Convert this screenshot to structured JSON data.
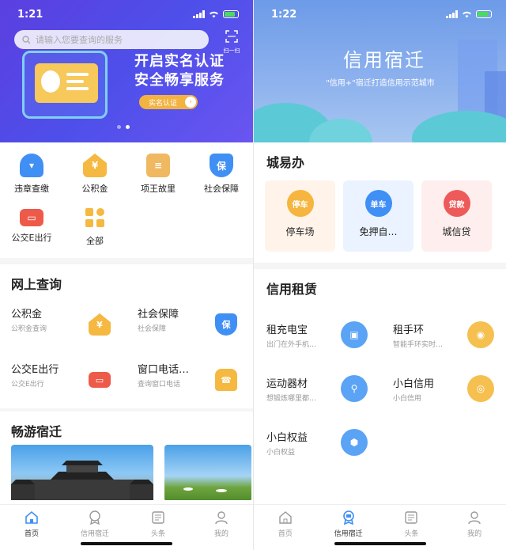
{
  "left": {
    "status": {
      "time": "1:21"
    },
    "search": {
      "placeholder": "请输入您要查询的服务"
    },
    "scan": {
      "label": "扫一扫"
    },
    "banner": {
      "line1": "开启实名认证",
      "line2": "安全畅享服务",
      "cta": "实名认证"
    },
    "grid": [
      {
        "label": "违章查缴",
        "icon": "police-hat-icon",
        "color": "#3f8ff5"
      },
      {
        "label": "公积金",
        "icon": "house-fund-icon",
        "color": "#f5b840"
      },
      {
        "label": "项王故里",
        "icon": "scroll-icon",
        "color": "#f0b860"
      },
      {
        "label": "社会保障",
        "icon": "shield-icon",
        "color": "#3f8ff5"
      },
      {
        "label": "公交E出行",
        "icon": "bus-icon",
        "color": "#ee5a4a"
      },
      {
        "label": "全部",
        "icon": "grid-all-icon",
        "color": "#f5b840"
      }
    ],
    "online_title": "网上查询",
    "queries": [
      {
        "title": "公积金",
        "sub": "公积金查询",
        "icon": "house-fund-icon"
      },
      {
        "title": "社会保障",
        "sub": "社会保障",
        "icon": "shield-icon"
      },
      {
        "title": "公交E出行",
        "sub": "公交E出行",
        "icon": "bus-icon"
      },
      {
        "title": "窗口电话…",
        "sub": "查询窗口电话",
        "icon": "telephone-icon"
      }
    ],
    "tour_title": "畅游宿迁",
    "tabs": [
      "首页",
      "信用宿迁",
      "头条",
      "我的"
    ]
  },
  "right": {
    "status": {
      "time": "1:22"
    },
    "banner": {
      "title": "信用宿迁",
      "sub": "\"信用+\"宿迁打造信用示范城市"
    },
    "city_title": "城易办",
    "city_cards": [
      {
        "label": "停车场",
        "badge": "停车",
        "icon": "parking-icon",
        "bg": "#fff3ea",
        "color": "#f5b53f"
      },
      {
        "label": "免押自…",
        "badge": "单车",
        "icon": "bike-icon",
        "bg": "#eaf3ff",
        "color": "#3f8ff5"
      },
      {
        "label": "城信贷",
        "badge": "贷款",
        "icon": "loan-icon",
        "bg": "#ffeeee",
        "color": "#ee5a5a"
      }
    ],
    "rent_title": "信用租赁",
    "rent_items": [
      {
        "title": "租充电宝",
        "sub": "出门在外手机…",
        "icon": "power-bank-icon",
        "color": "#5aa3f5"
      },
      {
        "title": "租手环",
        "sub": "智能手环实时…",
        "icon": "wristband-icon",
        "color": "#f5c050"
      },
      {
        "title": "运动器材",
        "sub": "想锻炼哪里都…",
        "icon": "sport-icon",
        "color": "#5aa3f5"
      },
      {
        "title": "小白信用",
        "sub": "小白信用",
        "icon": "credit-icon",
        "color": "#f5c050"
      },
      {
        "title": "小白权益",
        "sub": "小白权益",
        "icon": "rights-icon",
        "color": "#5aa3f5"
      }
    ],
    "tabs": [
      "首页",
      "信用宿迁",
      "头条",
      "我的"
    ]
  }
}
